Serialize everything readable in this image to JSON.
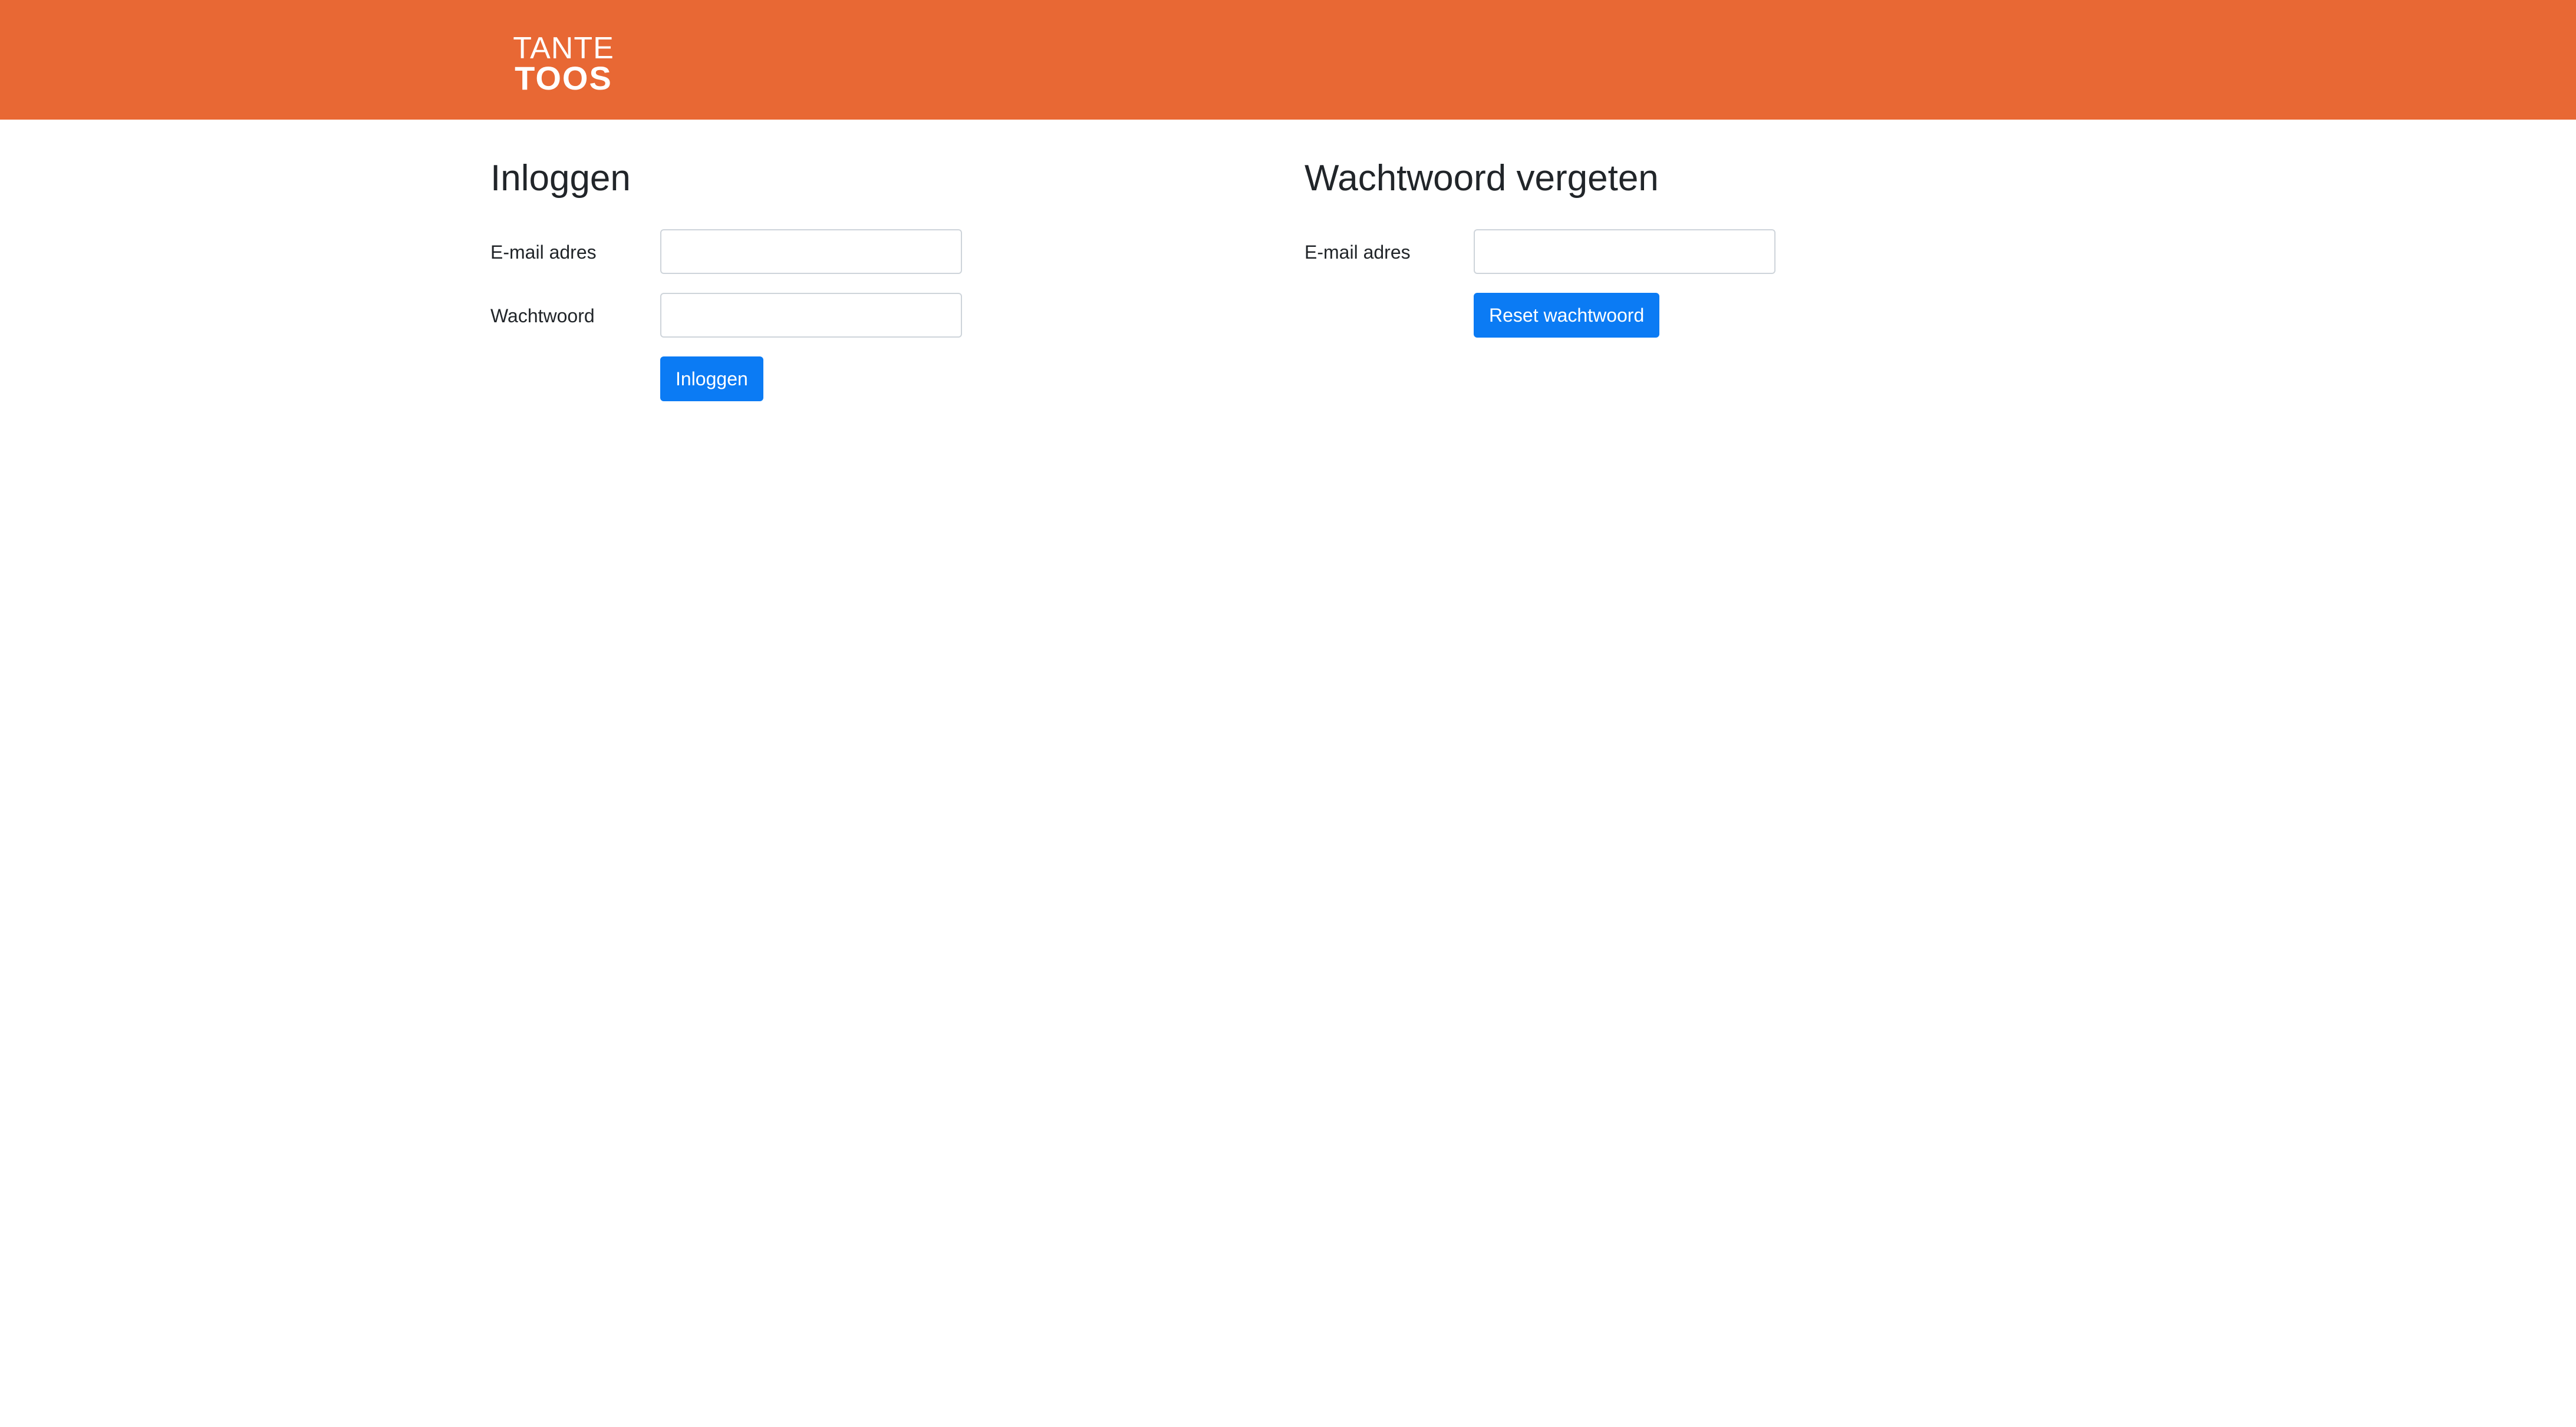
{
  "header": {
    "logo": {
      "line1": "TANTE",
      "line2": "TOOS"
    },
    "background_color": "#e86834"
  },
  "login": {
    "title": "Inloggen",
    "email_label": "E-mail adres",
    "email_value": "",
    "password_label": "Wachtwoord",
    "password_value": "",
    "submit_label": "Inloggen"
  },
  "forgot_password": {
    "title": "Wachtwoord vergeten",
    "email_label": "E-mail adres",
    "email_value": "",
    "submit_label": "Reset wachtwoord"
  },
  "colors": {
    "primary_button": "#0b7bf4",
    "text": "#212529"
  }
}
